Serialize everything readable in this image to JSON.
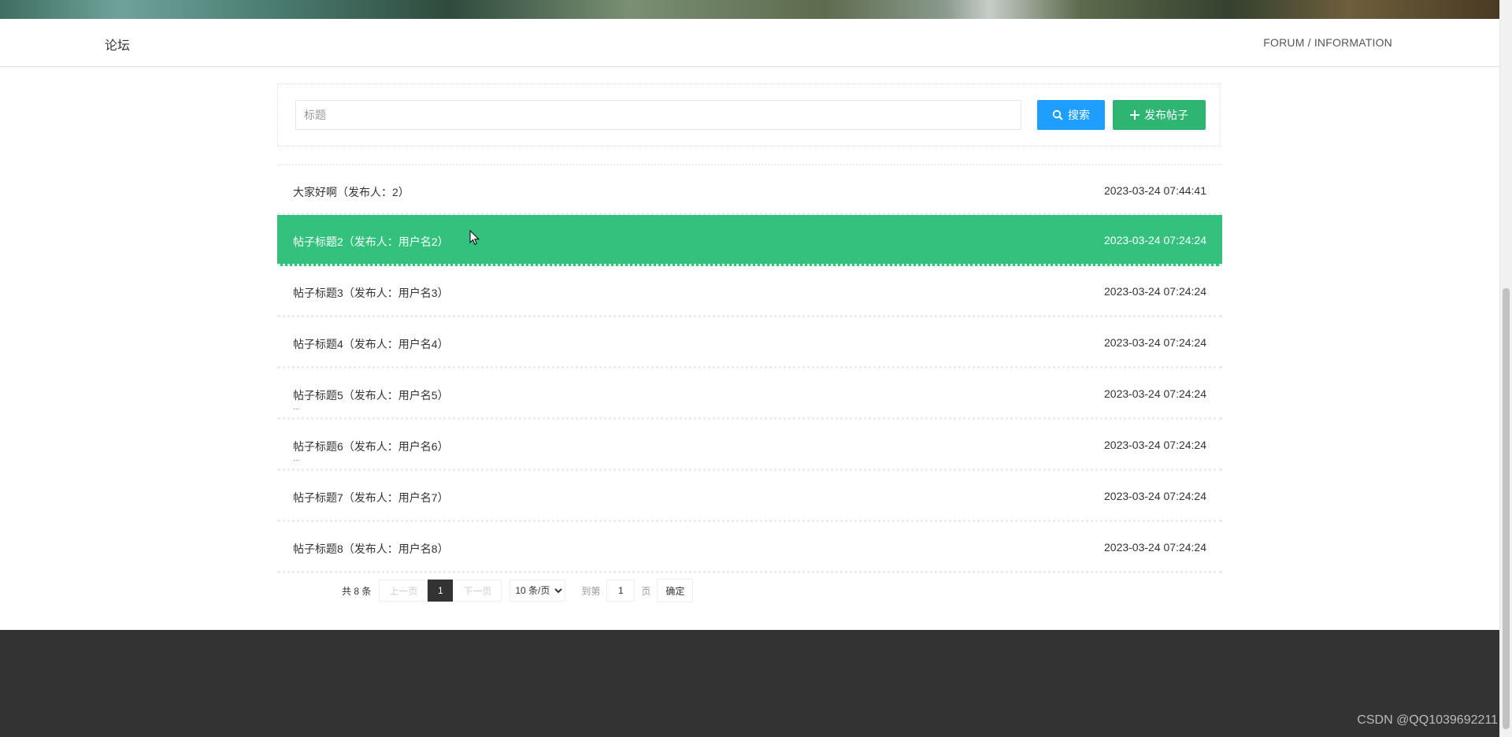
{
  "header": {
    "title": "论坛",
    "breadcrumb": "FORUM / INFORMATION"
  },
  "search": {
    "placeholder": "标题",
    "value": "",
    "search_label": "搜索",
    "add_label": "发布帖子"
  },
  "posts": [
    {
      "title": "大家好啊（发布人：2）",
      "time": "2023-03-24 07:44:41",
      "extra": ""
    },
    {
      "title": "帖子标题2（发布人：用户名2）",
      "time": "2023-03-24 07:24:24",
      "extra": ""
    },
    {
      "title": "帖子标题3（发布人：用户名3）",
      "time": "2023-03-24 07:24:24",
      "extra": ""
    },
    {
      "title": "帖子标题4（发布人：用户名4）",
      "time": "2023-03-24 07:24:24",
      "extra": ""
    },
    {
      "title": "帖子标题5（发布人：用户名5）",
      "time": "2023-03-24 07:24:24",
      "extra": "..."
    },
    {
      "title": "帖子标题6（发布人：用户名6）",
      "time": "2023-03-24 07:24:24",
      "extra": "..."
    },
    {
      "title": "帖子标题7（发布人：用户名7）",
      "time": "2023-03-24 07:24:24",
      "extra": ""
    },
    {
      "title": "帖子标题8（发布人：用户名8）",
      "time": "2023-03-24 07:24:24",
      "extra": ""
    }
  ],
  "pagination": {
    "total": "共 8 条",
    "prev": "上一页",
    "current": "1",
    "next": "下一页",
    "page_size": "10 条/页",
    "goto_label": "到第",
    "goto_value": "1",
    "page_label": "页",
    "confirm": "确定"
  },
  "watermark": "CSDN @QQ1039692211",
  "colors": {
    "active_row": "#33c17d",
    "search_button": "#1e9fff",
    "add_button": "#2fb572",
    "footer": "#333333"
  }
}
